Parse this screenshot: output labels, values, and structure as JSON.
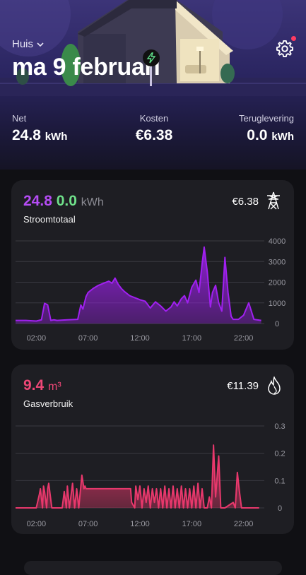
{
  "header": {
    "location": "Huis",
    "date": "ma 9 februari"
  },
  "summary": [
    {
      "label": "Net",
      "value": "24.8",
      "unit": "kWh"
    },
    {
      "label": "Kosten",
      "value": "€6.38",
      "unit": ""
    },
    {
      "label": "Teruglevering",
      "value": "0.0",
      "unit": "kWh"
    }
  ],
  "electricity": {
    "value_primary": "24.8",
    "value_secondary": "0.0",
    "unit": "kWh",
    "label": "Stroomtotaal",
    "cost": "€6.38",
    "icon": "power-pylon-icon",
    "color_primary": "#b54cf5",
    "color_secondary": "#6fe08a"
  },
  "gas": {
    "value": "9.4",
    "unit": "m³",
    "label": "Gasverbruik",
    "cost": "€11.39",
    "icon": "flame-icon",
    "color": "#ef4777"
  },
  "chart_data": [
    {
      "type": "area",
      "ylim": [
        0,
        4000
      ],
      "y_ticks": [
        "0",
        "1000",
        "2000",
        "3000",
        "4000"
      ],
      "x_ticks": [
        "02:00",
        "07:00",
        "12:00",
        "17:00",
        "22:00"
      ],
      "color": "#a020f0",
      "x": [
        0,
        1,
        2,
        2.5,
        2.8,
        3.1,
        3.4,
        3.7,
        4,
        5,
        6,
        6.3,
        6.5,
        6.8,
        7,
        7.5,
        8,
        8.5,
        9,
        9.3,
        9.6,
        9.9,
        10.2,
        10.5,
        11,
        11.5,
        12,
        12.5,
        13,
        13.5,
        14,
        14.5,
        15,
        15.3,
        15.6,
        16,
        16.3,
        16.6,
        17,
        17.4,
        17.7,
        18,
        18.2,
        18.5,
        18.8,
        19,
        19.3,
        19.6,
        19.9,
        20.2,
        20.5,
        20.8,
        21,
        21.5,
        22,
        22.5,
        23,
        23.7
      ],
      "y": [
        150,
        150,
        120,
        180,
        980,
        900,
        150,
        180,
        150,
        180,
        200,
        900,
        700,
        1300,
        1500,
        1700,
        1850,
        1950,
        2050,
        1950,
        2200,
        1900,
        1700,
        1550,
        1350,
        1250,
        1150,
        1080,
        750,
        1050,
        850,
        600,
        800,
        1050,
        850,
        1200,
        1350,
        1000,
        1750,
        2100,
        1500,
        2900,
        3700,
        2500,
        800,
        1500,
        1850,
        1000,
        600,
        3200,
        1500,
        350,
        200,
        200,
        400,
        1000,
        200,
        150
      ]
    },
    {
      "type": "area",
      "ylim": [
        0,
        0.3
      ],
      "y_ticks": [
        "0",
        "0.1",
        "0.2",
        "0.3"
      ],
      "x_ticks": [
        "02:00",
        "07:00",
        "12:00",
        "17:00",
        "22:00"
      ],
      "color": "#e8386c",
      "x": [
        0,
        2,
        2.3,
        2.4,
        2.6,
        2.7,
        2.8,
        3.0,
        3.1,
        3.2,
        3.5,
        4.5,
        4.7,
        4.9,
        5.0,
        5.2,
        5.5,
        5.7,
        5.9,
        6.1,
        6.4,
        6.6,
        6.7,
        6.8,
        11.1,
        11.2,
        11.5,
        11.6,
        11.8,
        12,
        12.2,
        12.4,
        12.6,
        12.8,
        13.0,
        13.2,
        13.4,
        13.6,
        13.8,
        14.0,
        14.2,
        14.4,
        14.6,
        14.8,
        15.0,
        15.2,
        15.4,
        15.6,
        15.8,
        16.0,
        16.2,
        16.4,
        16.6,
        16.8,
        17.0,
        17.2,
        17.4,
        17.6,
        17.8,
        18.0,
        18.2,
        18.5,
        18.7,
        18.9,
        19.1,
        19.3,
        19.6,
        19.8,
        20,
        20.2,
        21,
        21.2,
        21.4,
        21.6,
        21.8,
        22,
        22.5,
        23.5
      ],
      "y": [
        0,
        0,
        0.05,
        0.07,
        0,
        0.08,
        0.06,
        0,
        0.07,
        0.09,
        0,
        0,
        0.06,
        0,
        0.08,
        0,
        0.09,
        0,
        0.07,
        0,
        0.12,
        0.07,
        0.08,
        0.07,
        0.07,
        0.02,
        0,
        0.08,
        0.03,
        0.08,
        0,
        0.07,
        0.02,
        0.08,
        0,
        0.07,
        0.02,
        0.07,
        0,
        0.07,
        0,
        0.08,
        0,
        0.07,
        0,
        0.08,
        0,
        0.07,
        0,
        0.08,
        0,
        0.07,
        0,
        0.07,
        0,
        0.08,
        0,
        0.09,
        0,
        0.07,
        0,
        0,
        0.04,
        0,
        0.23,
        0.04,
        0.19,
        0,
        0,
        0,
        0.02,
        0,
        0.13,
        0.06,
        0,
        0,
        0,
        0
      ]
    }
  ]
}
